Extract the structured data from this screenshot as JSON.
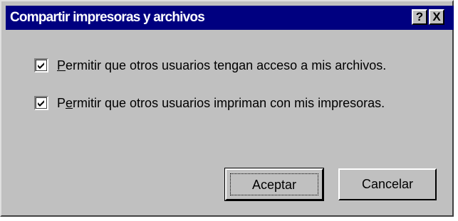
{
  "dialog": {
    "title": "Compartir impresoras y archivos",
    "help_button": "?",
    "close_button": "X"
  },
  "options": [
    {
      "label_prefix": "",
      "label_mnemonic": "P",
      "label_rest": "ermitir que otros usuarios tengan acceso a mis archivos.",
      "checked": true
    },
    {
      "label_prefix": "P",
      "label_mnemonic": "e",
      "label_rest": "rmitir que otros usuarios impriman con mis impresoras.",
      "checked": true
    }
  ],
  "buttons": {
    "ok_label": "Aceptar",
    "cancel_label": "Cancelar"
  },
  "colors": {
    "titlebar": "#000080",
    "face": "#c0c0c0"
  }
}
